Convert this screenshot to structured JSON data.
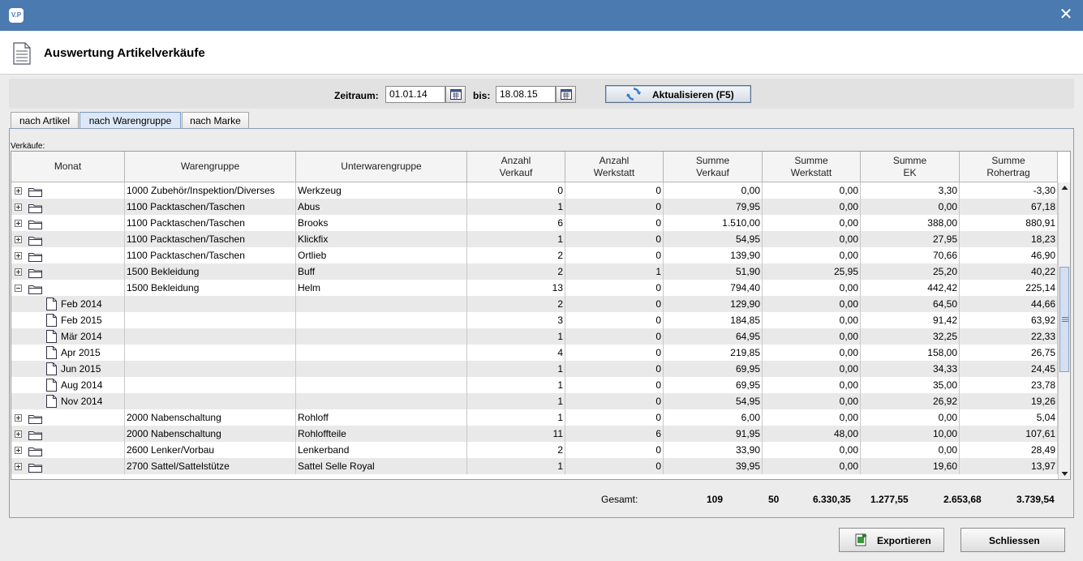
{
  "window": {
    "app_icon_text": "V.P",
    "close_glyph": "✕"
  },
  "header": {
    "title": "Auswertung Artikelverkäufe",
    "icon": "document-icon"
  },
  "filter": {
    "period_label": "Zeitraum:",
    "from_value": "01.01.14",
    "to_label": "bis:",
    "to_value": "18.08.15",
    "refresh_label": "Aktualisieren (F5)"
  },
  "tabs": [
    {
      "label": "nach Artikel",
      "active": false
    },
    {
      "label": "nach Warengruppe",
      "active": true
    },
    {
      "label": "nach Marke",
      "active": false
    }
  ],
  "table": {
    "caption": "Verkäufe:",
    "headers": [
      "Monat",
      "Warengruppe",
      "Unterwarengruppe",
      "Anzahl\nVerkauf",
      "Anzahl\nWerkstatt",
      "Summe\nVerkauf",
      "Summe\nWerkstatt",
      "Summe\nEK",
      "Summe\nRohertrag"
    ],
    "rows": [
      {
        "kind": "group",
        "expanded": false,
        "month": "",
        "warengruppe": "1000 Zubehör/Inspektion/Diverses",
        "unterwarengruppe": "Werkzeug",
        "anz_verkauf": "0",
        "anz_werkstatt": "0",
        "sum_verkauf": "0,00",
        "sum_werkstatt": "0,00",
        "sum_ek": "3,30",
        "sum_rohertrag": "-3,30"
      },
      {
        "kind": "group",
        "expanded": false,
        "month": "",
        "warengruppe": "1100 Packtaschen/Taschen",
        "unterwarengruppe": "Abus",
        "anz_verkauf": "1",
        "anz_werkstatt": "0",
        "sum_verkauf": "79,95",
        "sum_werkstatt": "0,00",
        "sum_ek": "0,00",
        "sum_rohertrag": "67,18"
      },
      {
        "kind": "group",
        "expanded": false,
        "month": "",
        "warengruppe": "1100 Packtaschen/Taschen",
        "unterwarengruppe": "Brooks",
        "anz_verkauf": "6",
        "anz_werkstatt": "0",
        "sum_verkauf": "1.510,00",
        "sum_werkstatt": "0,00",
        "sum_ek": "388,00",
        "sum_rohertrag": "880,91"
      },
      {
        "kind": "group",
        "expanded": false,
        "month": "",
        "warengruppe": "1100 Packtaschen/Taschen",
        "unterwarengruppe": "Klickfix",
        "anz_verkauf": "1",
        "anz_werkstatt": "0",
        "sum_verkauf": "54,95",
        "sum_werkstatt": "0,00",
        "sum_ek": "27,95",
        "sum_rohertrag": "18,23"
      },
      {
        "kind": "group",
        "expanded": false,
        "month": "",
        "warengruppe": "1100 Packtaschen/Taschen",
        "unterwarengruppe": "Ortlieb",
        "anz_verkauf": "2",
        "anz_werkstatt": "0",
        "sum_verkauf": "139,90",
        "sum_werkstatt": "0,00",
        "sum_ek": "70,66",
        "sum_rohertrag": "46,90"
      },
      {
        "kind": "group",
        "expanded": false,
        "month": "",
        "warengruppe": "1500 Bekleidung",
        "unterwarengruppe": "Buff",
        "anz_verkauf": "2",
        "anz_werkstatt": "1",
        "sum_verkauf": "51,90",
        "sum_werkstatt": "25,95",
        "sum_ek": "25,20",
        "sum_rohertrag": "40,22"
      },
      {
        "kind": "group",
        "expanded": true,
        "month": "",
        "warengruppe": "1500 Bekleidung",
        "unterwarengruppe": "Helm",
        "anz_verkauf": "13",
        "anz_werkstatt": "0",
        "sum_verkauf": "794,40",
        "sum_werkstatt": "0,00",
        "sum_ek": "442,42",
        "sum_rohertrag": "225,14"
      },
      {
        "kind": "leaf",
        "month": "Feb 2014",
        "warengruppe": "",
        "unterwarengruppe": "",
        "anz_verkauf": "2",
        "anz_werkstatt": "0",
        "sum_verkauf": "129,90",
        "sum_werkstatt": "0,00",
        "sum_ek": "64,50",
        "sum_rohertrag": "44,66"
      },
      {
        "kind": "leaf",
        "month": "Feb 2015",
        "warengruppe": "",
        "unterwarengruppe": "",
        "anz_verkauf": "3",
        "anz_werkstatt": "0",
        "sum_verkauf": "184,85",
        "sum_werkstatt": "0,00",
        "sum_ek": "91,42",
        "sum_rohertrag": "63,92"
      },
      {
        "kind": "leaf",
        "month": "Mär 2014",
        "warengruppe": "",
        "unterwarengruppe": "",
        "anz_verkauf": "1",
        "anz_werkstatt": "0",
        "sum_verkauf": "64,95",
        "sum_werkstatt": "0,00",
        "sum_ek": "32,25",
        "sum_rohertrag": "22,33"
      },
      {
        "kind": "leaf",
        "month": "Apr 2015",
        "warengruppe": "",
        "unterwarengruppe": "",
        "anz_verkauf": "4",
        "anz_werkstatt": "0",
        "sum_verkauf": "219,85",
        "sum_werkstatt": "0,00",
        "sum_ek": "158,00",
        "sum_rohertrag": "26,75"
      },
      {
        "kind": "leaf",
        "month": "Jun 2015",
        "warengruppe": "",
        "unterwarengruppe": "",
        "anz_verkauf": "1",
        "anz_werkstatt": "0",
        "sum_verkauf": "69,95",
        "sum_werkstatt": "0,00",
        "sum_ek": "34,33",
        "sum_rohertrag": "24,45"
      },
      {
        "kind": "leaf",
        "month": "Aug 2014",
        "warengruppe": "",
        "unterwarengruppe": "",
        "anz_verkauf": "1",
        "anz_werkstatt": "0",
        "sum_verkauf": "69,95",
        "sum_werkstatt": "0,00",
        "sum_ek": "35,00",
        "sum_rohertrag": "23,78"
      },
      {
        "kind": "leaf",
        "month": "Nov 2014",
        "warengruppe": "",
        "unterwarengruppe": "",
        "anz_verkauf": "1",
        "anz_werkstatt": "0",
        "sum_verkauf": "54,95",
        "sum_werkstatt": "0,00",
        "sum_ek": "26,92",
        "sum_rohertrag": "19,26"
      },
      {
        "kind": "group",
        "expanded": false,
        "month": "",
        "warengruppe": "2000 Nabenschaltung",
        "unterwarengruppe": "Rohloff",
        "anz_verkauf": "1",
        "anz_werkstatt": "0",
        "sum_verkauf": "6,00",
        "sum_werkstatt": "0,00",
        "sum_ek": "0,00",
        "sum_rohertrag": "5,04"
      },
      {
        "kind": "group",
        "expanded": false,
        "month": "",
        "warengruppe": "2000 Nabenschaltung",
        "unterwarengruppe": "Rohloffteile",
        "anz_verkauf": "11",
        "anz_werkstatt": "6",
        "sum_verkauf": "91,95",
        "sum_werkstatt": "48,00",
        "sum_ek": "10,00",
        "sum_rohertrag": "107,61"
      },
      {
        "kind": "group",
        "expanded": false,
        "month": "",
        "warengruppe": "2600 Lenker/Vorbau",
        "unterwarengruppe": "Lenkerband",
        "anz_verkauf": "2",
        "anz_werkstatt": "0",
        "sum_verkauf": "33,90",
        "sum_werkstatt": "0,00",
        "sum_ek": "0,00",
        "sum_rohertrag": "28,49"
      },
      {
        "kind": "group",
        "expanded": false,
        "month": "",
        "warengruppe": "2700 Sattel/Sattelstütze",
        "unterwarengruppe": "Sattel Selle Royal",
        "anz_verkauf": "1",
        "anz_werkstatt": "0",
        "sum_verkauf": "39,95",
        "sum_werkstatt": "0,00",
        "sum_ek": "19,60",
        "sum_rohertrag": "13,97"
      }
    ]
  },
  "totals": {
    "label": "Gesamt:",
    "anz_verkauf": "109",
    "anz_werkstatt": "50",
    "sum_verkauf": "6.330,35",
    "sum_werkstatt": "1.277,55",
    "sum_ek": "2.653,68",
    "sum_rohertrag": "3.739,54"
  },
  "buttons": {
    "export_label": "Exportieren",
    "close_label": "Schliessen"
  }
}
